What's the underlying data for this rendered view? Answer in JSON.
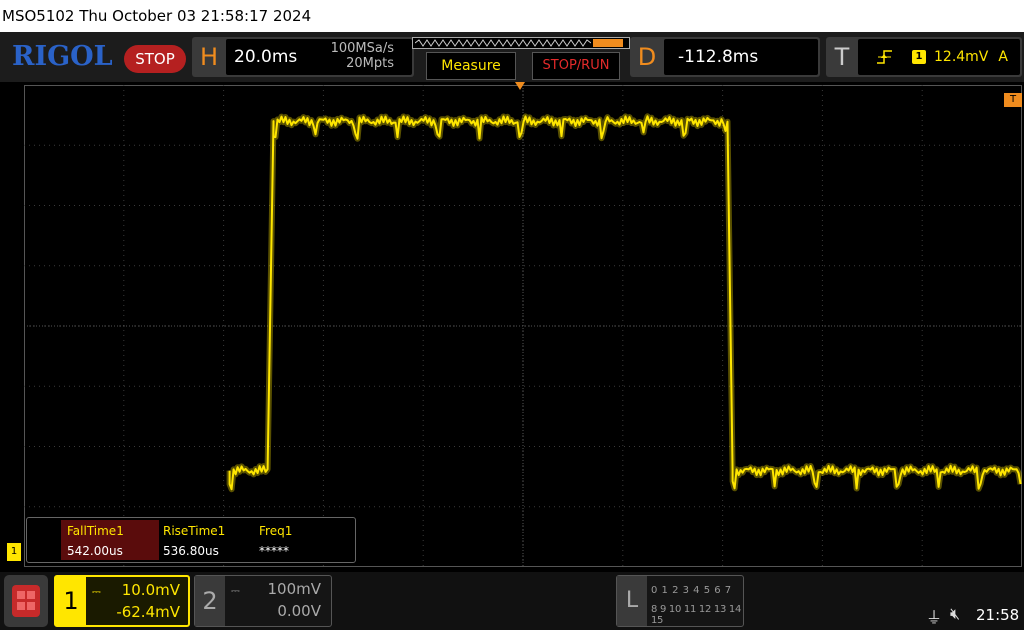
{
  "titlebar": {
    "text": "MSO5102  Thu October 03 21:58:17 2024"
  },
  "header": {
    "logo": "RIGOL",
    "run_state": "STOP",
    "horizontal": {
      "letter": "H",
      "scale": "20.0ms",
      "sample_rate": "100MSa/s",
      "mem_depth": "20Mpts"
    },
    "measure_button": "Measure",
    "stoprun_button": "STOP/RUN",
    "delay": {
      "letter": "D",
      "value": "-112.8ms"
    },
    "trigger": {
      "letter": "T",
      "source": "1",
      "level": "12.4mV",
      "mode": "A"
    }
  },
  "markers": {
    "trigger_level": "T",
    "ch1": "1"
  },
  "measurements": [
    {
      "label": "FallTime1",
      "value": "542.00us",
      "selected": true
    },
    {
      "label": "RiseTime1",
      "value": "536.80us",
      "selected": false
    },
    {
      "label": "Freq1",
      "value": "*****",
      "selected": false
    }
  ],
  "channels": {
    "ch1": {
      "num": "1",
      "scale": "10.0mV",
      "offset": "-62.4mV",
      "color": "#ffe600"
    },
    "ch2": {
      "num": "2",
      "scale": "100mV",
      "offset": "0.00V",
      "color": "#aaaaaa"
    }
  },
  "logic_analyzer": {
    "letter": "L",
    "row1": "0 1 2 3  4 5 6 7",
    "row2": "8 9 10 11 12 13 14 15"
  },
  "status": {
    "time": "21:58",
    "usb_icon": "usb-icon",
    "sound_icon": "sound-muted-icon"
  },
  "waveform": {
    "trace_color": "#ffe600",
    "segments": [
      {
        "from_div": 2.06,
        "to_div": 2.46,
        "level_div": -2.4
      },
      {
        "from_div": 2.5,
        "to_div": 7.06,
        "level_div": 3.4
      },
      {
        "from_div": 7.1,
        "to_div": 10.0,
        "level_div": -2.4
      }
    ]
  }
}
